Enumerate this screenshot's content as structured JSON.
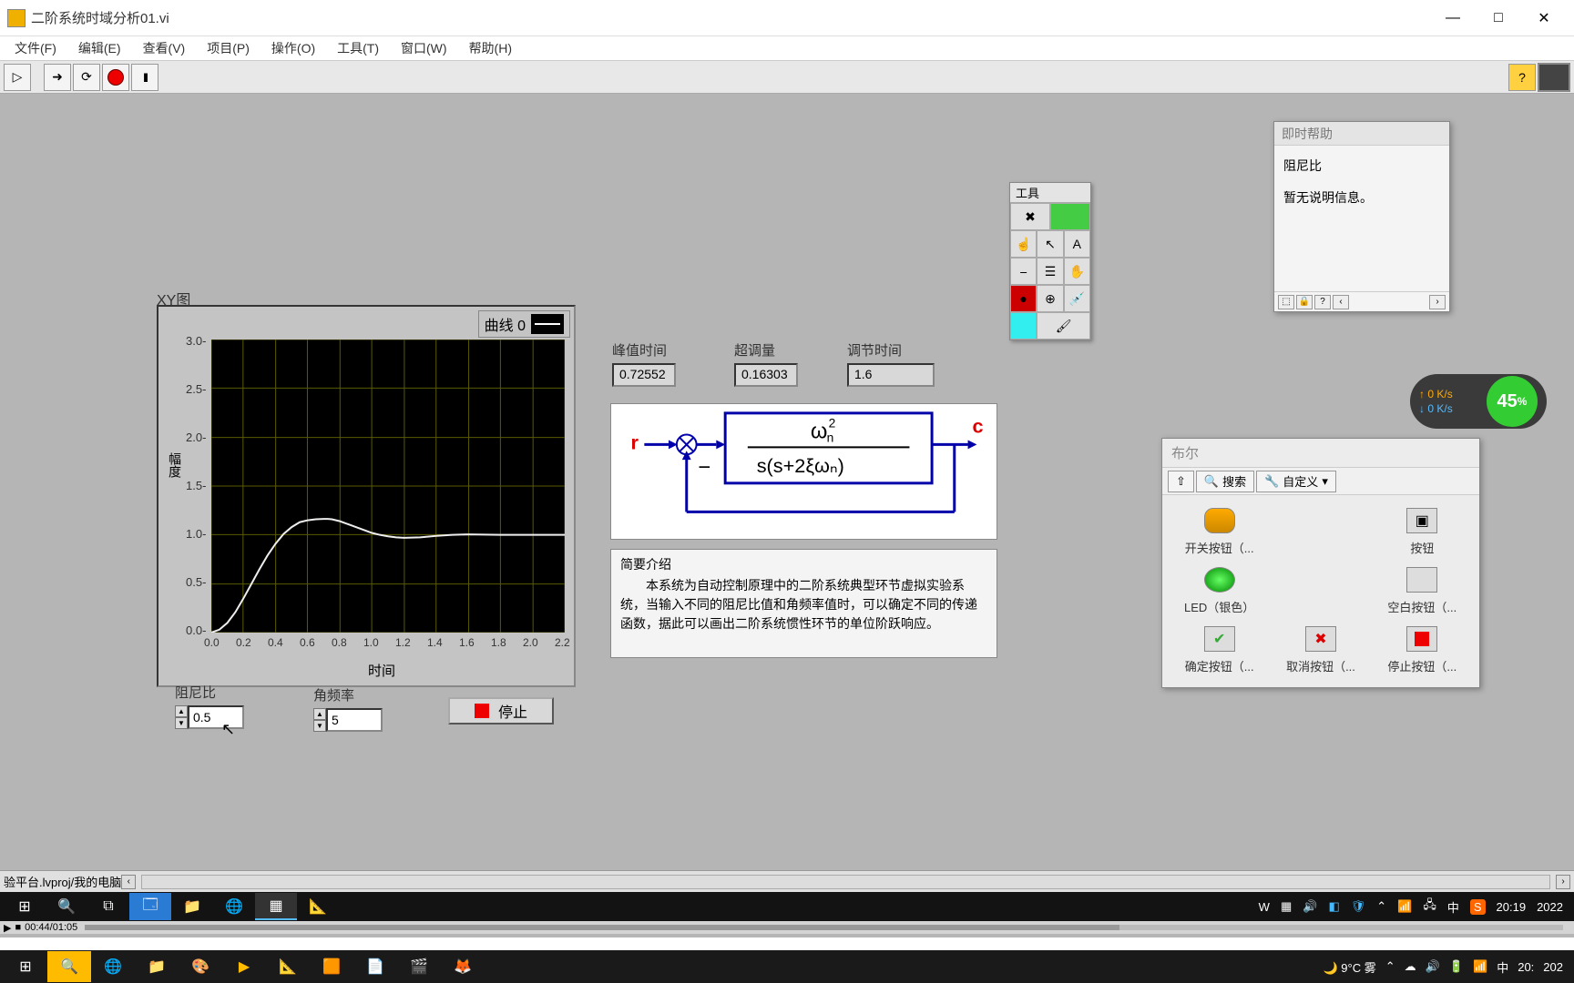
{
  "window": {
    "title": "二阶系统时域分析01.vi",
    "min": "—",
    "max": "□",
    "close": "✕"
  },
  "menu": {
    "file": "文件(F)",
    "edit": "编辑(E)",
    "view": "查看(V)",
    "project": "项目(P)",
    "operate": "操作(O)",
    "tools": "工具(T)",
    "window": "窗口(W)",
    "help": "帮助(H)"
  },
  "graph": {
    "title": "XY图",
    "legend": "曲线 0",
    "ylabel": "幅度",
    "xlabel": "时间",
    "yticks": [
      "3.0-",
      "2.5-",
      "2.0-",
      "1.5-",
      "1.0-",
      "0.5-",
      "0.0-"
    ],
    "xticks": [
      "0.0",
      "0.2",
      "0.4",
      "0.6",
      "0.8",
      "1.0",
      "1.2",
      "1.4",
      "1.6",
      "1.8",
      "2.0",
      "2.2"
    ]
  },
  "indicators": {
    "peak_time_label": "峰值时间",
    "peak_time": "0.72552",
    "overshoot_label": "超调量",
    "overshoot": "0.16303",
    "settle_label": "调节时间",
    "settle": "1.6"
  },
  "formula": {
    "r": "r",
    "c": "c",
    "num": "ω",
    "num_sub": "n",
    "num_sup": "2",
    "den": "s(s+2ξωₙ)"
  },
  "desc": {
    "header": "简要介绍",
    "body": "　　本系统为自动控制原理中的二阶系统典型环节虚拟实验系统，当输入不同的阻尼比值和角频率值时，可以确定不同的传递函数，据此可以画出二阶系统惯性环节的单位阶跃响应。"
  },
  "controls": {
    "damp_label": "阻尼比",
    "damp": "0.5",
    "freq_label": "角频率",
    "freq": "5",
    "stop": "停止"
  },
  "tools_palette": {
    "title": "工具"
  },
  "ctxhelp": {
    "title": "即时帮助",
    "name": "阻尼比",
    "info": "暂无说明信息。"
  },
  "boolpal": {
    "title": "布尔",
    "search": "搜索",
    "custom": "自定义",
    "items": [
      "开关按钮（...",
      "按钮",
      "LED（银色）",
      "空白按钮（...",
      "确定按钮（...",
      "取消按钮（...",
      "停止按钮（..."
    ]
  },
  "battery": {
    "up": "0 K/s",
    "down": "0 K/s",
    "pct": "45",
    "pctunit": "%"
  },
  "project_bar": "验平台.lvproj/我的电脑",
  "taskbar1": {
    "weather": "9°C 雾",
    "ime": "中",
    "sogou": "S",
    "time": "20:19",
    "date": "2022"
  },
  "video": {
    "time": "00:44/01:05"
  },
  "taskbar2": {
    "weather": "9°C 雾",
    "ime": "中",
    "time": "20:",
    "date": "202"
  },
  "chart_data": {
    "type": "line",
    "title": "XY图",
    "xlabel": "时间",
    "ylabel": "幅度",
    "xlim": [
      0,
      2.2
    ],
    "ylim": [
      0,
      3.0
    ],
    "series": [
      {
        "name": "曲线 0",
        "x": [
          0,
          0.05,
          0.1,
          0.15,
          0.2,
          0.25,
          0.3,
          0.35,
          0.4,
          0.45,
          0.5,
          0.55,
          0.6,
          0.65,
          0.7,
          0.725,
          0.75,
          0.8,
          0.85,
          0.9,
          0.95,
          1.0,
          1.05,
          1.1,
          1.15,
          1.2,
          1.3,
          1.4,
          1.5,
          1.6,
          1.8,
          2.0,
          2.2
        ],
        "y": [
          0,
          0.03,
          0.1,
          0.21,
          0.35,
          0.5,
          0.65,
          0.79,
          0.91,
          1.01,
          1.08,
          1.13,
          1.15,
          1.16,
          1.163,
          1.163,
          1.16,
          1.14,
          1.11,
          1.08,
          1.05,
          1.02,
          1.0,
          0.985,
          0.975,
          0.97,
          0.975,
          0.99,
          1.0,
          1.005,
          1.0,
          1.0,
          1.0
        ]
      }
    ]
  }
}
